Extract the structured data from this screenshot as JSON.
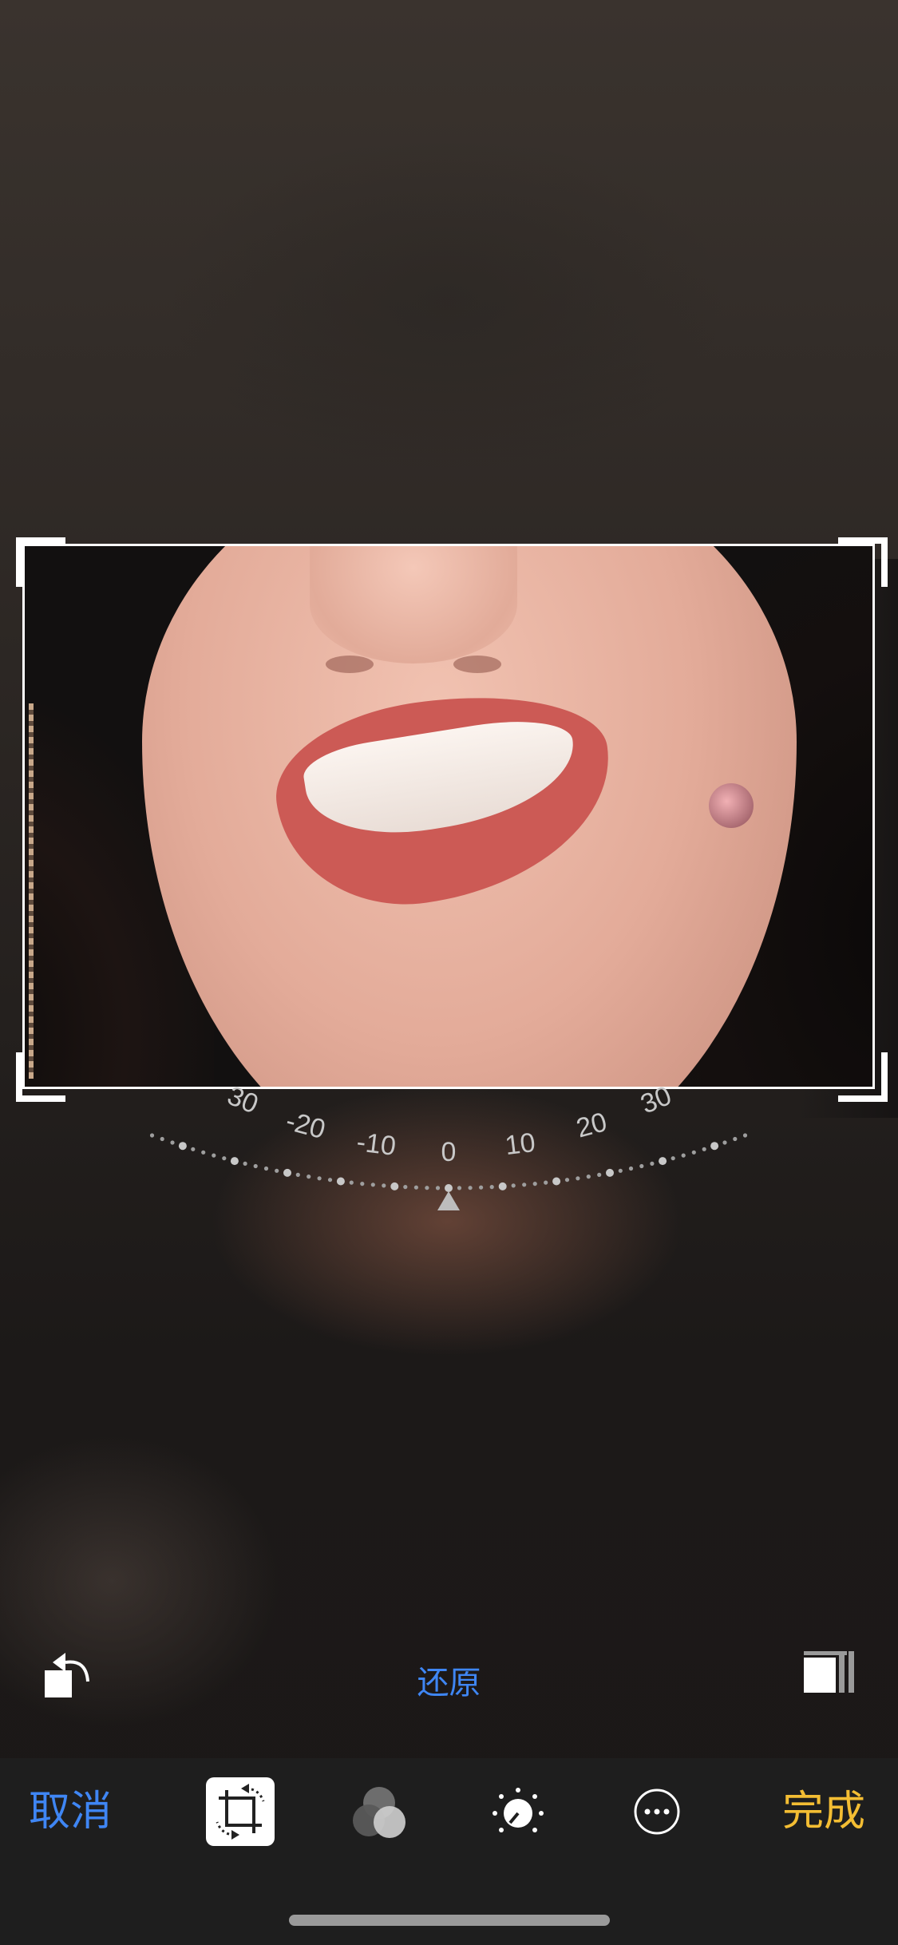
{
  "editor": {
    "reset_label": "还原",
    "cancel_label": "取消",
    "done_label": "完成"
  },
  "straighten_dial": {
    "tick_labels": [
      "30",
      "-20",
      "-10",
      "0",
      "10",
      "20",
      "30"
    ],
    "current_value": 0
  },
  "tools": [
    {
      "name": "crop-rotate",
      "icon": "crop-icon",
      "selected": true
    },
    {
      "name": "filters",
      "icon": "filters-icon",
      "selected": false
    },
    {
      "name": "adjust",
      "icon": "adjust-dial-icon",
      "selected": false
    },
    {
      "name": "more",
      "icon": "more-icon",
      "selected": false
    }
  ],
  "colors": {
    "accent_blue": "#3f86f4",
    "done_yellow": "#f3bd33",
    "toolbar_bg": "#1e1e1e"
  }
}
